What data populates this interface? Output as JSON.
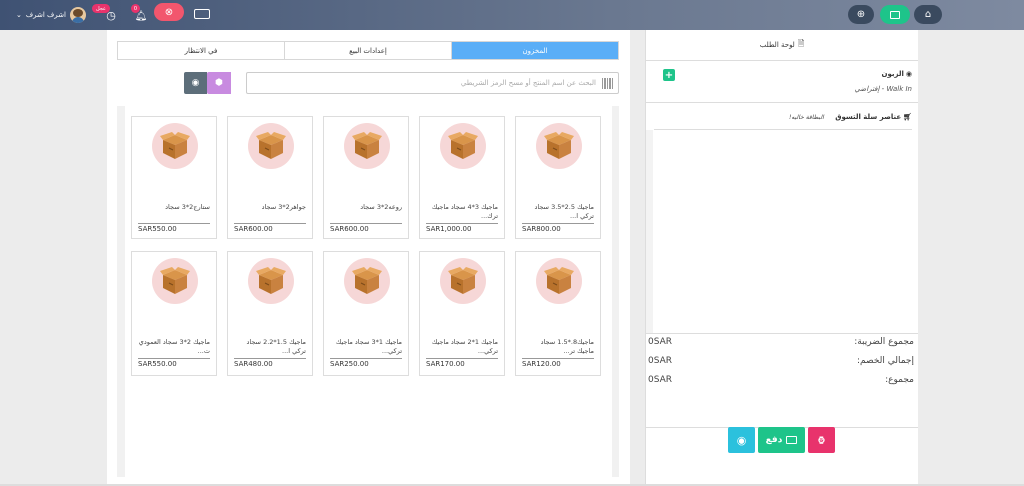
{
  "topbar": {
    "user_name": "اشرف اشرف",
    "badge_top": "عجل",
    "notif_count": "0",
    "icons": [
      "home-icon",
      "cash-register-icon",
      "plus-circle-icon",
      "keyboard-icon",
      "close-circle-icon",
      "bell-icon",
      "clock-icon",
      "user-avatar-icon"
    ]
  },
  "tabs": [
    {
      "label": "المخزون",
      "active": true
    },
    {
      "label": "إعدادات البيع",
      "active": false
    },
    {
      "label": "في الانتظار",
      "active": false
    }
  ],
  "search": {
    "placeholder": "البحث عن اسم المنتج أو مسح الرمز الشريطي"
  },
  "products_row1": [
    {
      "name": "ماجيك 2.5*3.5 سجاد تركي ا...",
      "price": "SAR800.00"
    },
    {
      "name": "ماجيك 3*4 سجاد ماجيك ترك...",
      "price": "SAR1,000.00"
    },
    {
      "name": "روعه2*3 سجاد",
      "price": "SAR600.00"
    },
    {
      "name": "جواهر2*3 سجاد",
      "price": "SAR600.00"
    },
    {
      "name": "ستارج2*3 سجاد",
      "price": "SAR550.00"
    }
  ],
  "products_row2": [
    {
      "name": "ماجيك8.*1.5 سجاد ماجيك تر...",
      "price": "SAR120.00"
    },
    {
      "name": "ماجيك 1*2 سجاد ماجيك تركي...",
      "price": "SAR170.00"
    },
    {
      "name": "ماجيك 1*3 سجاد ماجيك تركي...",
      "price": "SAR250.00"
    },
    {
      "name": "ماجيك 1.5*2.2 سجاد تركي ا...",
      "price": "SAR480.00"
    },
    {
      "name": "ماجيك 2*3 سجاد العمودي ت...",
      "price": "SAR550.00"
    }
  ],
  "order_panel": {
    "title": "لوحة الطلب",
    "customer_label": "الزبون",
    "customer_value": "Walk In - إفتراضي",
    "cart_label": "عناصر سلة التسوق",
    "cart_empty": "البطاقة خاليه!"
  },
  "totals": [
    {
      "label": "مجموع الضريبة:",
      "value": "0SAR"
    },
    {
      "label": "إجمالي الخصم:",
      "value": "0SAR"
    },
    {
      "label": "مجموع:",
      "value": "0SAR"
    }
  ],
  "actions": {
    "pay_label": "دفع"
  },
  "colors": {
    "accent": "#5aaef7",
    "green": "#1ec48a",
    "pink": "#e8336c",
    "cyan": "#2bc1dd",
    "purple": "#c88be0",
    "slate": "#5d6e7a"
  }
}
